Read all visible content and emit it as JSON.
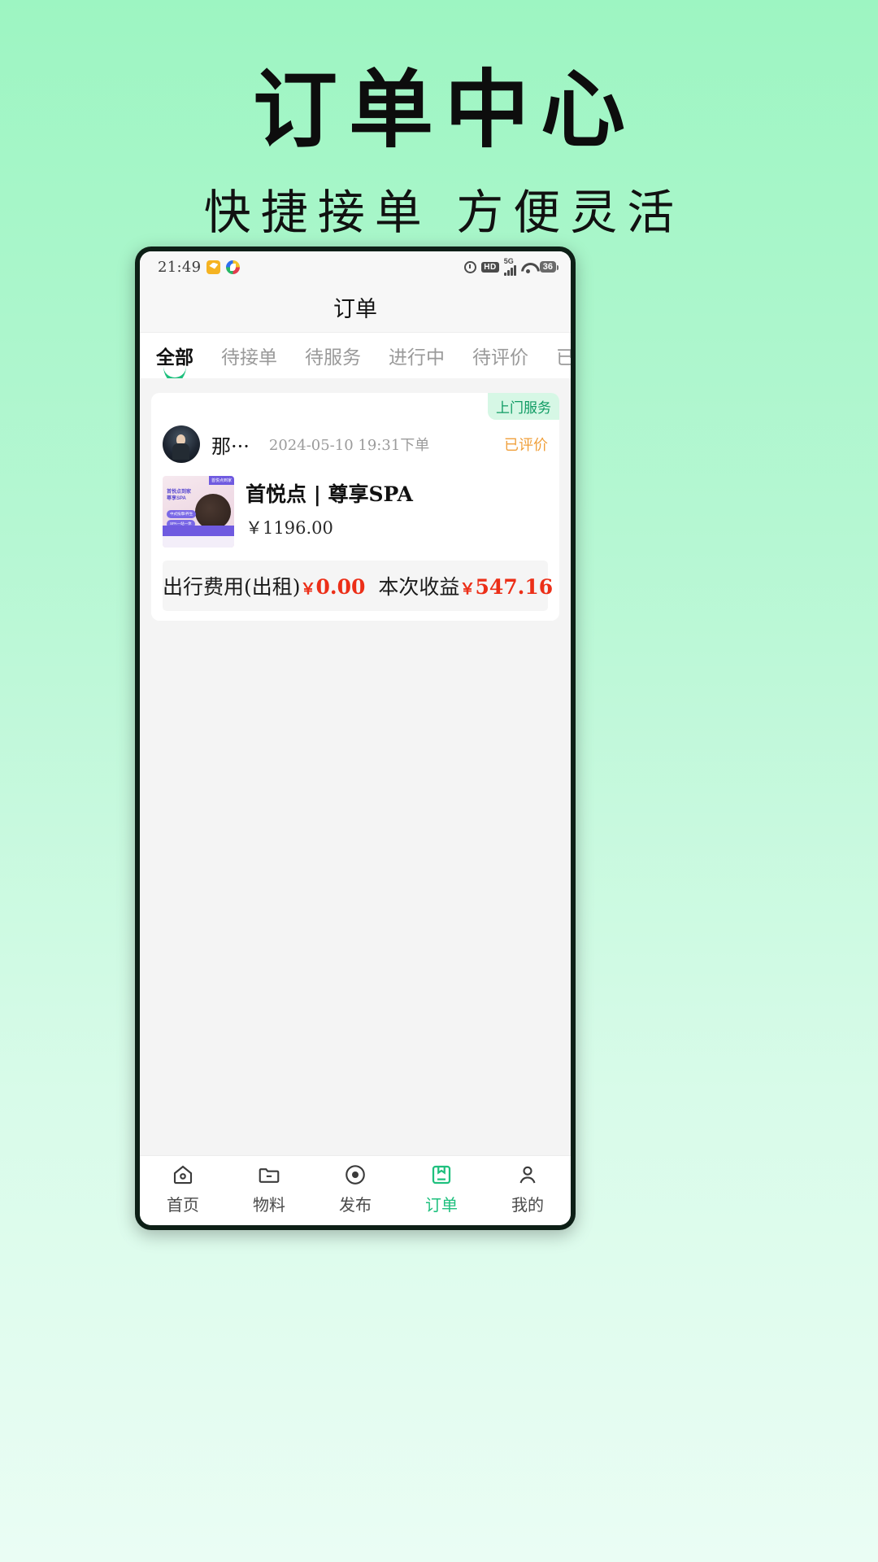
{
  "poster": {
    "title": "订单中心",
    "subtitle": "快捷接单 方便灵活",
    "bg_top": "#9df5c2",
    "bg_bottom": "#eafdf4"
  },
  "statusbar": {
    "time": "21:49",
    "app_icon_1": "yellow-app-icon",
    "app_icon_2": "colorful-app-icon",
    "alarm_icon": "alarm-icon",
    "hd_label": "HD",
    "network_label": "5G",
    "wifi_icon": "wifi-icon",
    "battery": "36"
  },
  "header": {
    "title": "订单"
  },
  "tabs": {
    "items": [
      {
        "label": "全部",
        "active": true
      },
      {
        "label": "待接单",
        "active": false
      },
      {
        "label": "待服务",
        "active": false
      },
      {
        "label": "进行中",
        "active": false
      },
      {
        "label": "待评价",
        "active": false
      },
      {
        "label": "已完成",
        "active": false
      }
    ],
    "active_color": "#1fc07e"
  },
  "order": {
    "service_badge": "上门服务",
    "user_name": "那···",
    "order_time": "2024-05-10 19:31下单",
    "status": "已评价",
    "status_color": "#f0a03c",
    "product_title": "首悦点 | 尊享SPA",
    "product_price": "￥1196.00",
    "thumb_tag": "首悦点到家",
    "thumb_title": "首悦点到家\n尊享SPA",
    "thumb_pill_1": "中式按摩/养生",
    "thumb_pill_2": "SPA一站一体",
    "earn_label_1": "出行费用(出租)",
    "earn_yen_1": "￥",
    "earn_value_1": "0.00",
    "earn_label_2": "本次收益",
    "earn_yen_2": "￥",
    "earn_value_2": "547.16",
    "amount_color": "#ec2f18"
  },
  "bottomnav": {
    "items": [
      {
        "label": "首页",
        "icon": "home-icon",
        "active": false
      },
      {
        "label": "物料",
        "icon": "folder-icon",
        "active": false
      },
      {
        "label": "发布",
        "icon": "publish-icon",
        "active": false
      },
      {
        "label": "订单",
        "icon": "order-icon",
        "active": true
      },
      {
        "label": "我的",
        "icon": "user-icon",
        "active": false
      }
    ],
    "active_color": "#1fc07e"
  }
}
